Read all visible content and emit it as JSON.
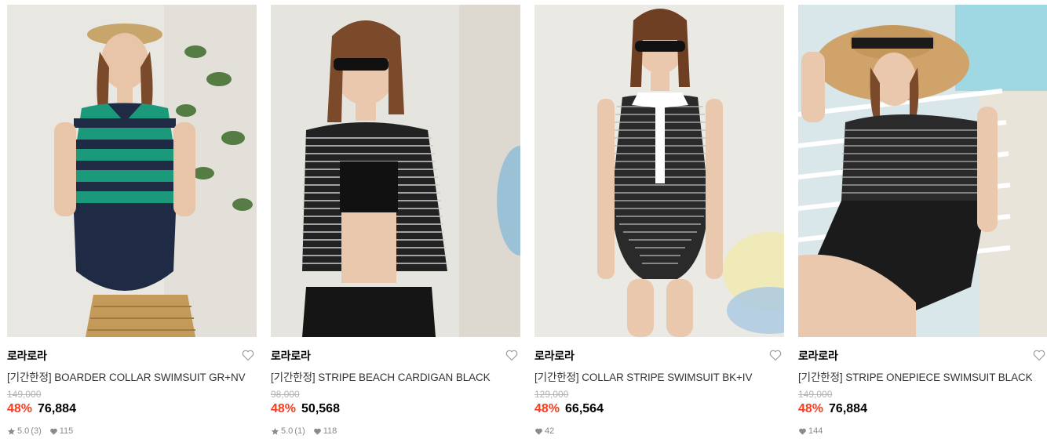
{
  "products": [
    {
      "brand": "로라로라",
      "name": "[기간한정] BOARDER COLLAR SWIMSUIT GR+NV",
      "original_price": "149,000",
      "discount_rate": "48%",
      "final_price": "76,884",
      "rating": "5.0",
      "review_count": "(3)",
      "likes": "115",
      "image_desc_colors": {
        "bg": "#e9e7e1",
        "top_a": "#1a9a7a",
        "top_b": "#1f2a44",
        "bottom": "#1f2a44"
      }
    },
    {
      "brand": "로라로라",
      "name": "[기간한정] STRIPE BEACH CARDIGAN BLACK",
      "original_price": "98,000",
      "discount_rate": "48%",
      "final_price": "50,568",
      "rating": "5.0",
      "review_count": "(1)",
      "likes": "118",
      "image_desc_colors": {
        "bg": "#e6e4de",
        "top_a": "#222222",
        "top_b": "#cfcfcf",
        "bottom": "#1a1a1a"
      }
    },
    {
      "brand": "로라로라",
      "name": "[기간한정] COLLAR STRIPE SWIMSUIT BK+IV",
      "original_price": "129,000",
      "discount_rate": "48%",
      "final_price": "66,564",
      "rating": "",
      "review_count": "",
      "likes": "42",
      "image_desc_colors": {
        "bg": "#ebe9e3",
        "top_a": "#2a2a2a",
        "top_b": "#bdbdbd",
        "bottom": "#2a2a2a"
      }
    },
    {
      "brand": "로라로라",
      "name": "[기간한정] STRIPE ONEPIECE SWIMSUIT BLACK",
      "original_price": "149,000",
      "discount_rate": "48%",
      "final_price": "76,884",
      "rating": "",
      "review_count": "",
      "likes": "144",
      "image_desc_colors": {
        "bg": "#d9e6ea",
        "top_a": "#2a2a2a",
        "top_b": "#b5b5b5",
        "bottom": "#1b1b1b"
      }
    }
  ],
  "icons": {
    "wishlist": "heart-outline-icon",
    "star": "star-icon",
    "like": "heart-filled-icon"
  },
  "colors": {
    "discount": "#ff3a1a",
    "muted": "#8a8a8a",
    "strike": "#b3b3b3"
  }
}
